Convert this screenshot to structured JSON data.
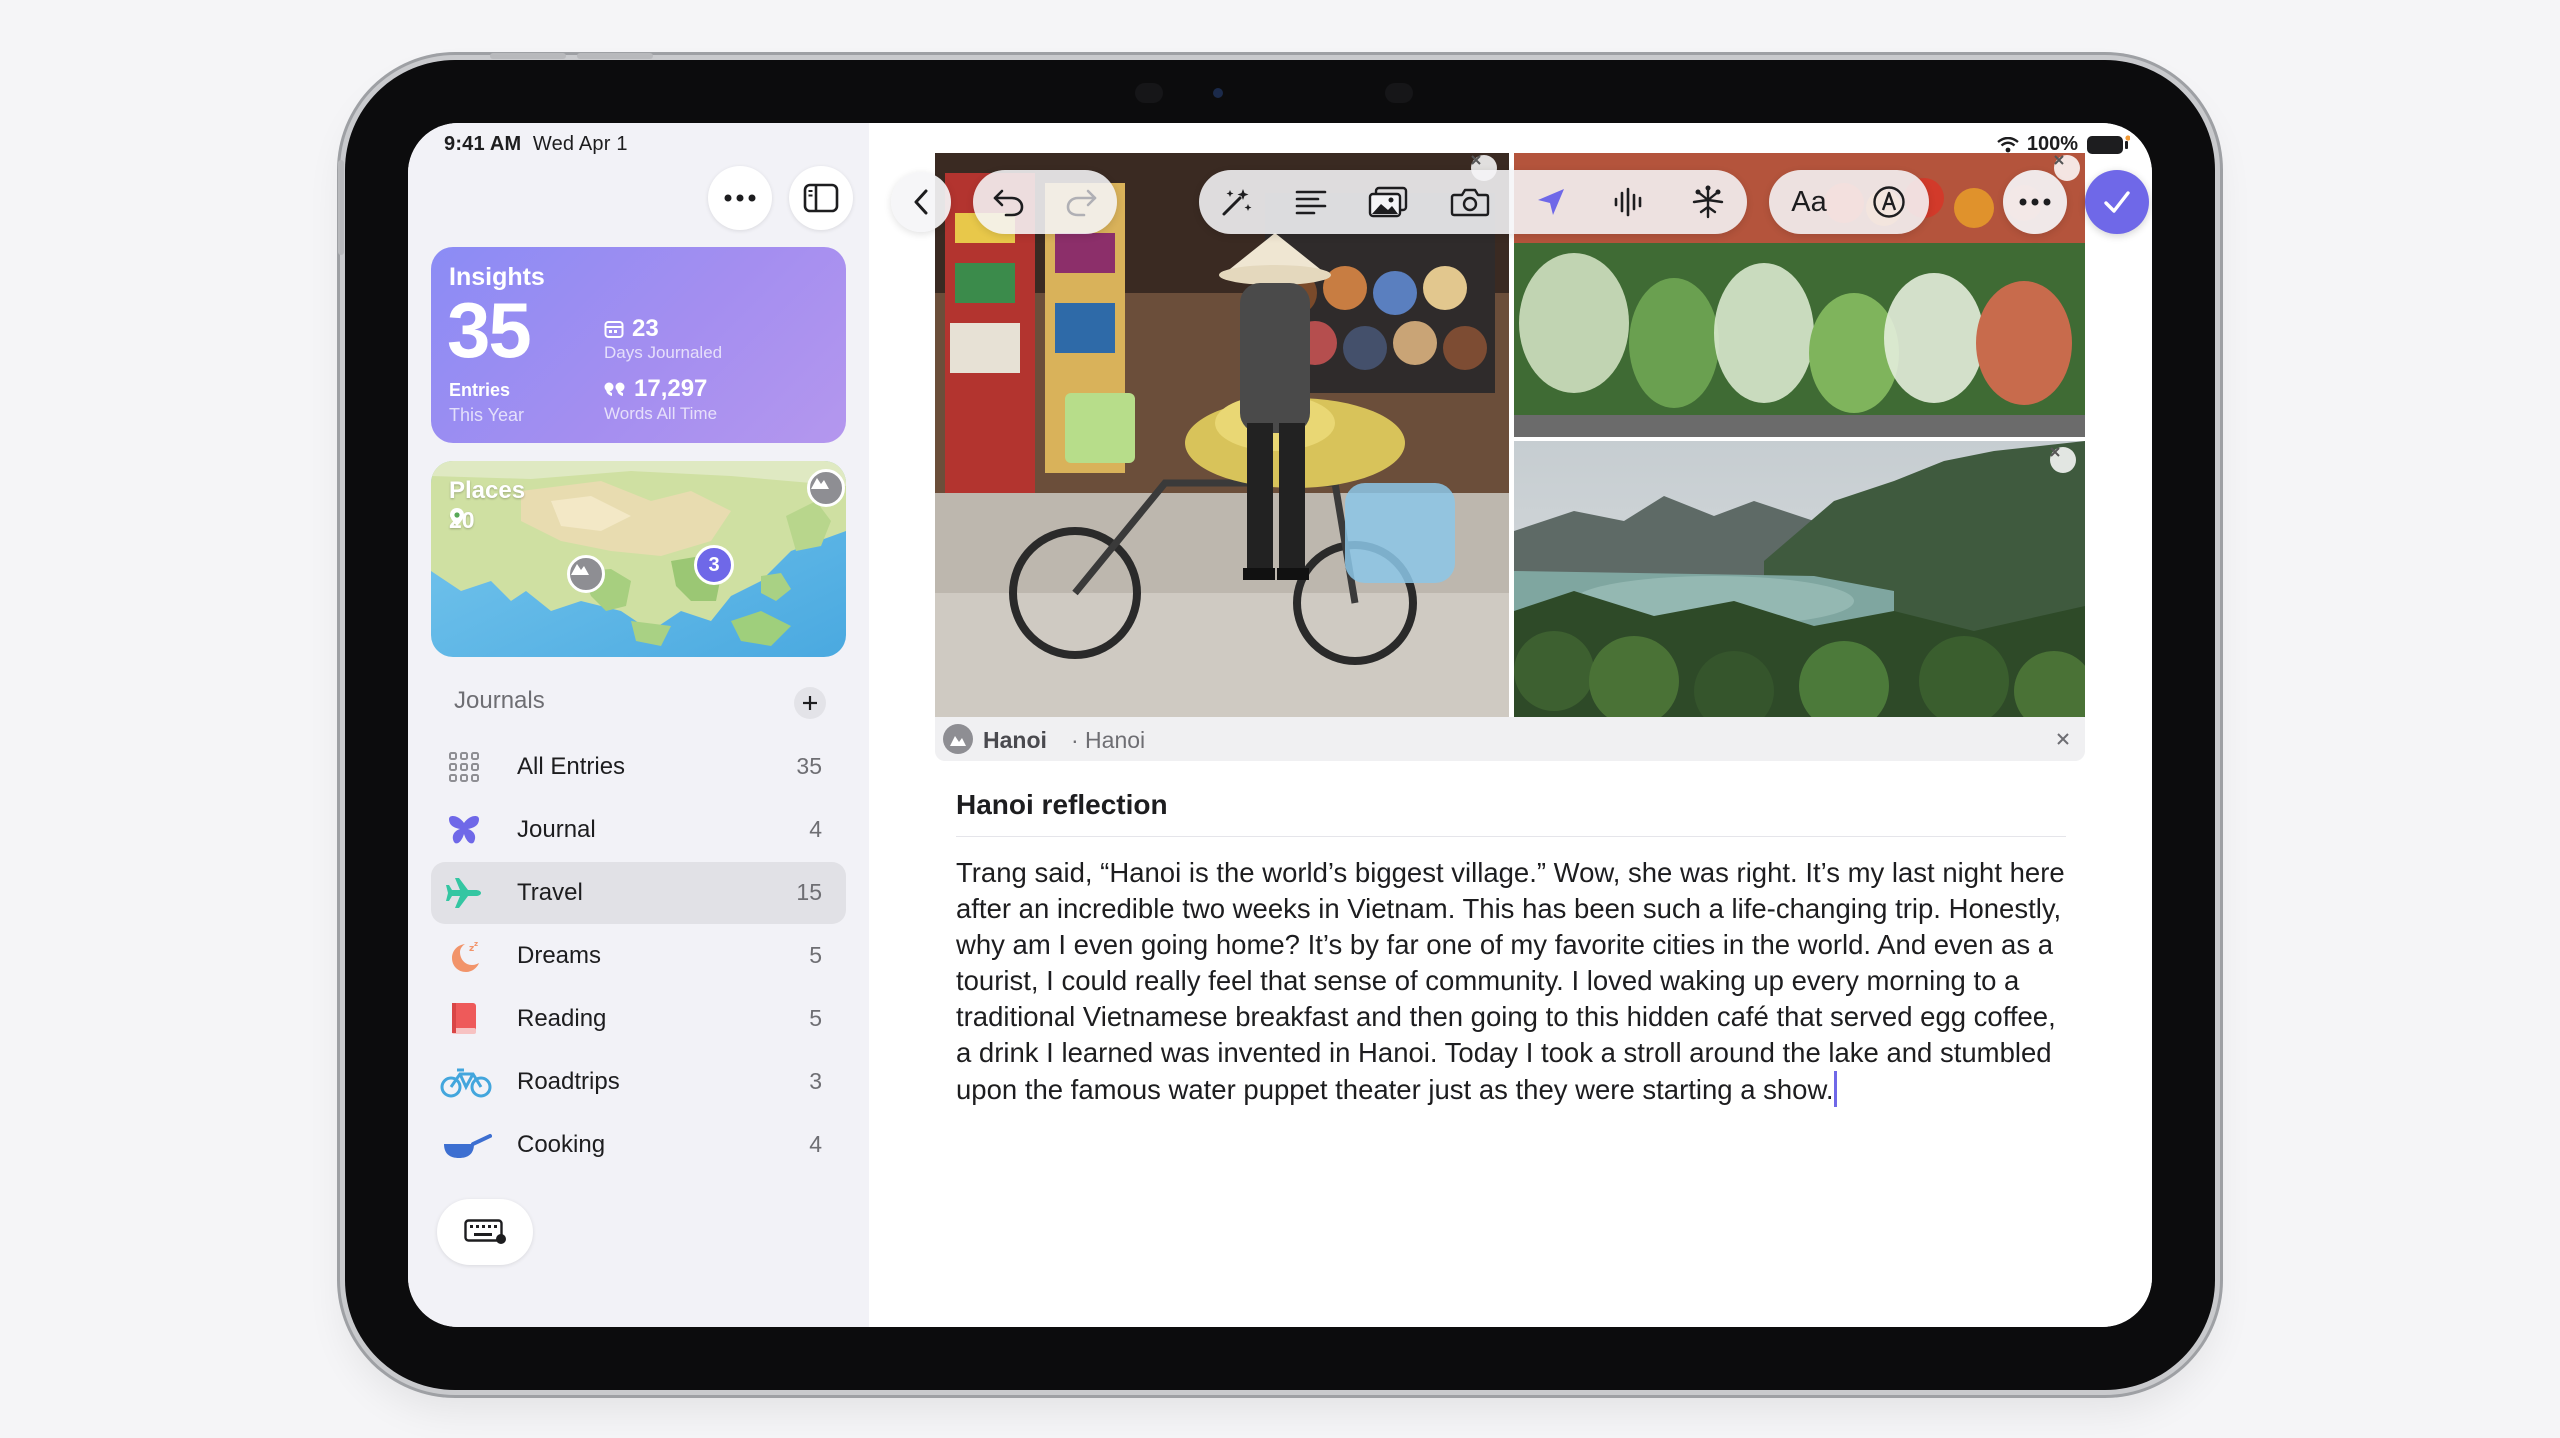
{
  "status": {
    "time": "9:41 AM",
    "date": "Wed Apr 1",
    "battery": "100%"
  },
  "insights": {
    "title": "Insights",
    "entries_value": "35",
    "entries_label": "Entries",
    "entries_sublabel": "This Year",
    "days_value": "23",
    "days_label": "Days Journaled",
    "words_value": "17,297",
    "words_label": "Words All Time"
  },
  "places": {
    "title": "Places",
    "count": "20",
    "cluster_badge": "3"
  },
  "journals": {
    "header": "Journals",
    "items": [
      {
        "label": "All Entries",
        "count": "35",
        "icon": "grid-icon",
        "color": "#8e8e93"
      },
      {
        "label": "Journal",
        "count": "4",
        "icon": "butterfly-icon",
        "color": "#6f68e8"
      },
      {
        "label": "Travel",
        "count": "15",
        "icon": "airplane-icon",
        "color": "#34c6a2",
        "selected": true
      },
      {
        "label": "Dreams",
        "count": "5",
        "icon": "moon-icon",
        "color": "#f2946a"
      },
      {
        "label": "Reading",
        "count": "5",
        "icon": "book-icon",
        "color": "#ee5a5a"
      },
      {
        "label": "Roadtrips",
        "count": "3",
        "icon": "bicycle-icon",
        "color": "#43a6dd"
      },
      {
        "label": "Cooking",
        "count": "4",
        "icon": "pan-icon",
        "color": "#3d6fd1"
      }
    ]
  },
  "entry": {
    "location_name": "Hanoi",
    "location_sub": "· Hanoi",
    "title": "Hanoi reflection",
    "body": "Trang said, “Hanoi is the world’s biggest village.” Wow, she was right. It’s my last night here after an incredible two weeks in Vietnam. This has been such a life-changing trip. Honestly, why am I even going home? It’s by far one of my favorite cities in the world. And even as a tourist, I could really feel that sense of community. I loved waking up every morning to a traditional Vietnamese breakfast and then going to this hidden café that served egg coffee, a drink I learned was invented in Hanoi. Today I took a stroll around the lake and stumbled upon the famous water puppet theater just as they were starting a show."
  },
  "toolbar": {
    "format_label": "Aa"
  },
  "colors": {
    "accent": "#6f68e8",
    "insights_gradient_start": "#8b8cf5",
    "insights_gradient_end": "#b497ee"
  }
}
